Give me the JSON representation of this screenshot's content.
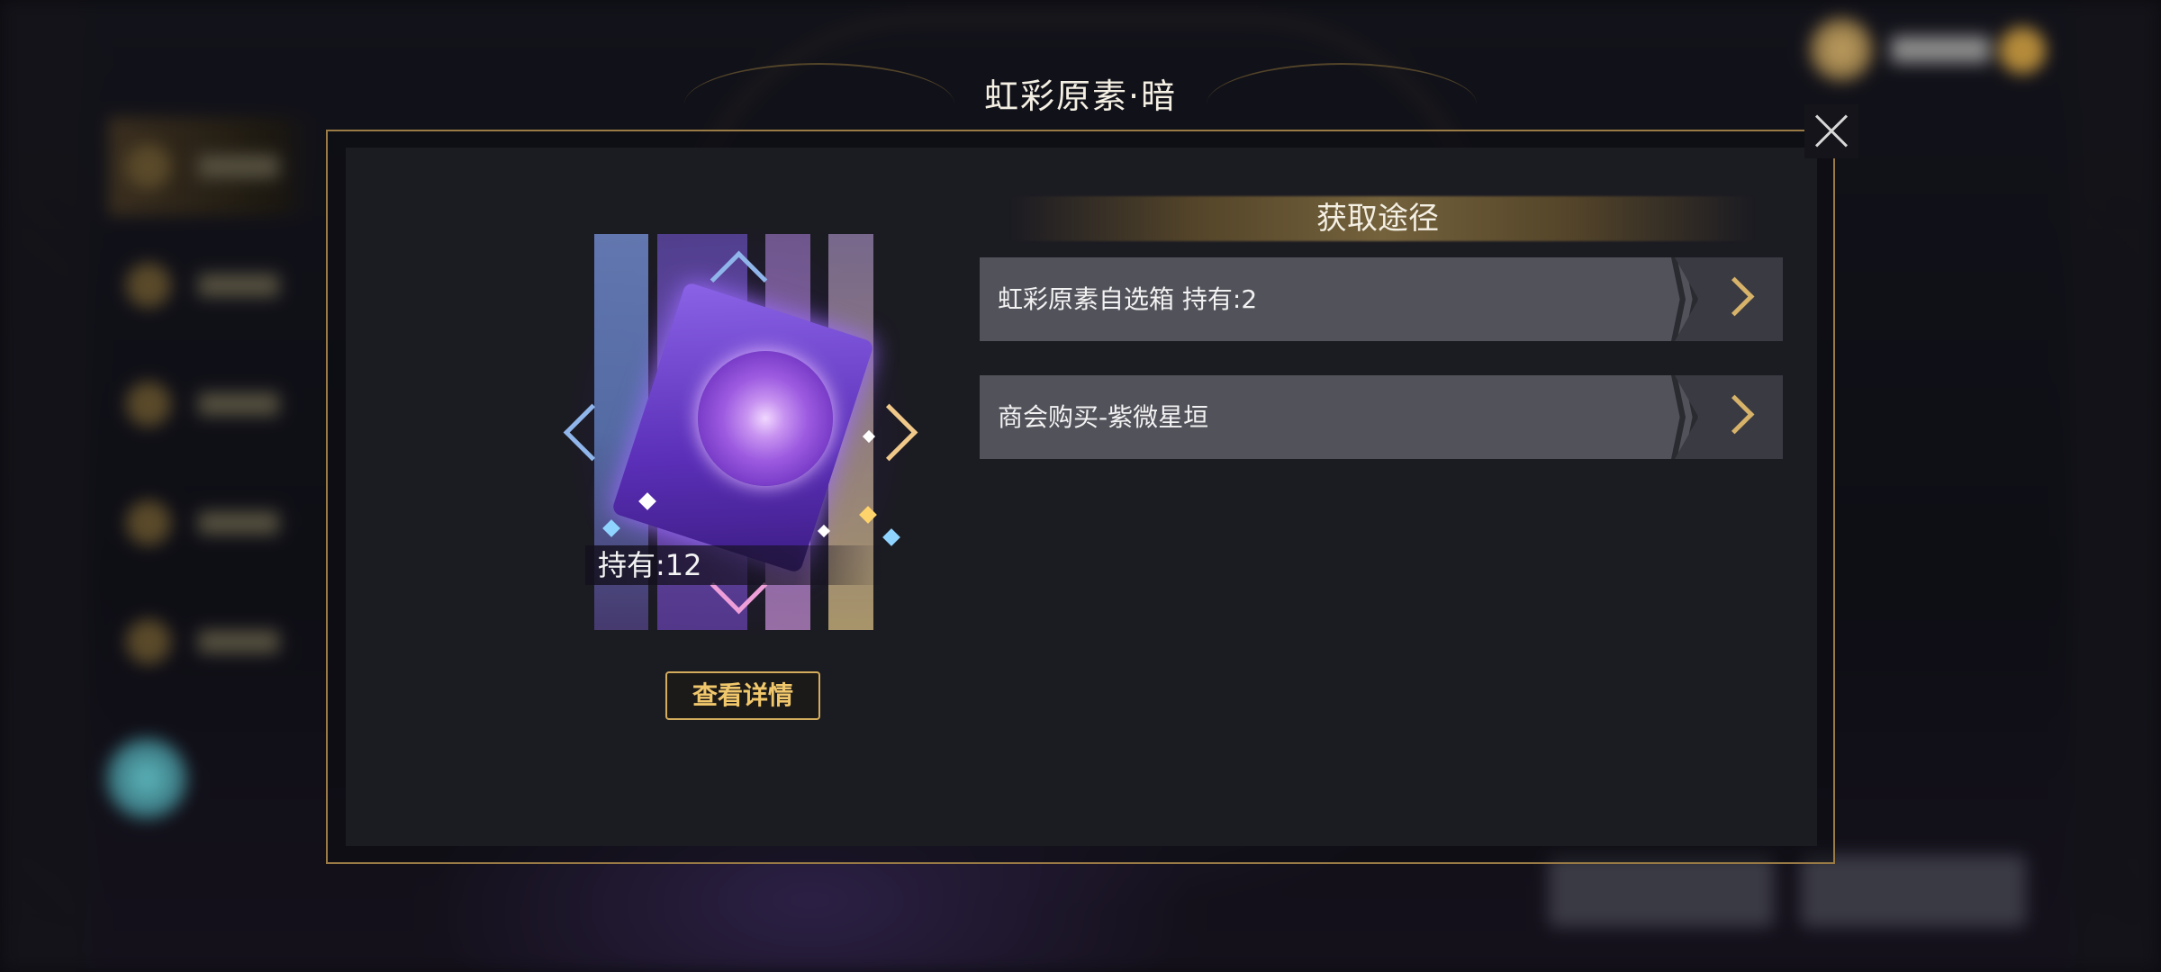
{
  "dialog": {
    "title": "虹彩原素·暗",
    "item": {
      "owned_text": "持有:12",
      "detail_button": "查看详情"
    },
    "acquire": {
      "section_title": "获取途径",
      "routes": [
        {
          "label": "虹彩原素自选箱 持有:2"
        },
        {
          "label": "商会购买-紫微星垣"
        }
      ]
    }
  },
  "colors": {
    "frame_gold": "#9a7b45",
    "button_gold": "#f1c76c",
    "route_bg": "#52525b",
    "panel_bg": "#1b1b22"
  },
  "icons": {
    "close": "close-icon",
    "route_arrow": "chevron-right-icon"
  }
}
